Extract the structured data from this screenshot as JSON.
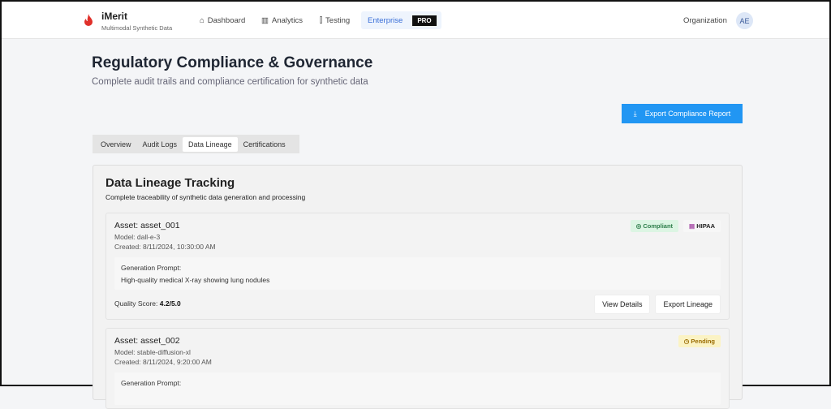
{
  "header": {
    "brand": "iMerit",
    "brand_sub": "Multimodal Synthetic Data",
    "nav": [
      {
        "label": "Dashboard",
        "icon": "home-icon"
      },
      {
        "label": "Analytics",
        "icon": "bar-chart-icon"
      },
      {
        "label": "Testing",
        "icon": "test-tube-icon"
      },
      {
        "label": "Enterprise",
        "badge": "PRO"
      }
    ],
    "org": "Organization",
    "avatar": "AE"
  },
  "page": {
    "title": "Regulatory Compliance & Governance",
    "subtitle": "Complete audit trails and compliance certification for synthetic data",
    "export_label": "Export Compliance Report"
  },
  "tabs": [
    "Overview",
    "Audit Logs",
    "Data Lineage",
    "Certifications"
  ],
  "lineage": {
    "title": "Data Lineage Tracking",
    "description": "Complete traceability of synthetic data generation and processing",
    "assets": [
      {
        "title": "Asset: asset_001",
        "model": "Model: dall-e-3",
        "created": "Created: 8/11/2024, 10:30:00 AM",
        "status": "Compliant",
        "tag": "HIPAA",
        "prompt_label": "Generation Prompt:",
        "prompt": "High-quality medical X-ray showing lung nodules",
        "quality_label": "Quality Score:",
        "quality": "4.2/5.0",
        "view": "View Details",
        "export": "Export Lineage"
      },
      {
        "title": "Asset: asset_002",
        "model": "Model: stable-diffusion-xl",
        "created": "Created: 8/11/2024, 9:20:00 AM",
        "status": "Pending",
        "prompt_label": "Generation Prompt:"
      }
    ]
  }
}
